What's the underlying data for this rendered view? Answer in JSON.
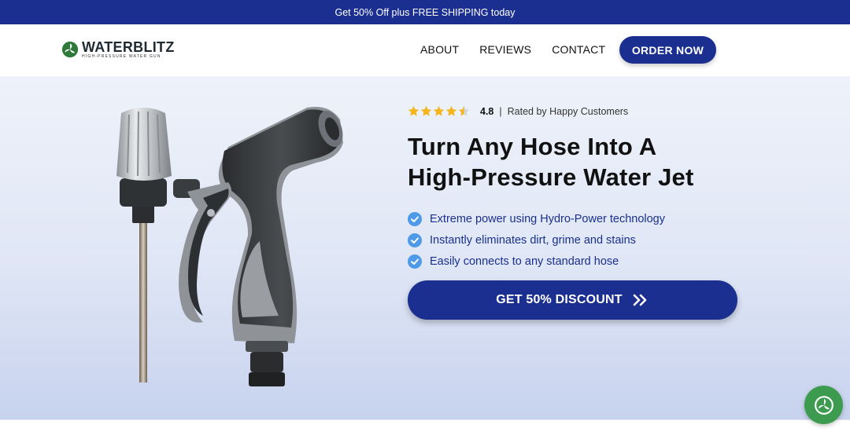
{
  "promo": {
    "text": "Get 50% Off plus FREE SHIPPING today"
  },
  "brand": {
    "name": "WATERBLITZ",
    "tagline": "HIGH-PRESSURE WATER GUN",
    "logo_icon": "leaf-circle-icon"
  },
  "nav": {
    "items": [
      "ABOUT",
      "REVIEWS",
      "CONTACT"
    ]
  },
  "header": {
    "order_label": "ORDER NOW"
  },
  "rating": {
    "stars": 4.5,
    "max_stars": 5,
    "value": "4.8",
    "separator": "|",
    "label": "Rated by Happy Customers"
  },
  "hero": {
    "headline_line1": "Turn Any Hose Into A",
    "headline_line2": "High-Pressure Water Jet",
    "features": [
      "Extreme power using Hydro-Power technology",
      "Instantly eliminates dirt, grime and stains",
      "Easily connects to any standard hose"
    ],
    "cta_label": "GET 50% DISCOUNT",
    "cta_icon": "double-chevron-right-icon"
  },
  "colors": {
    "primary": "#1a2f8f",
    "star": "#f3b51a",
    "check": "#4f9ae8",
    "chat": "#3c9b4f"
  },
  "chat": {
    "icon": "leaf-circle-icon"
  }
}
